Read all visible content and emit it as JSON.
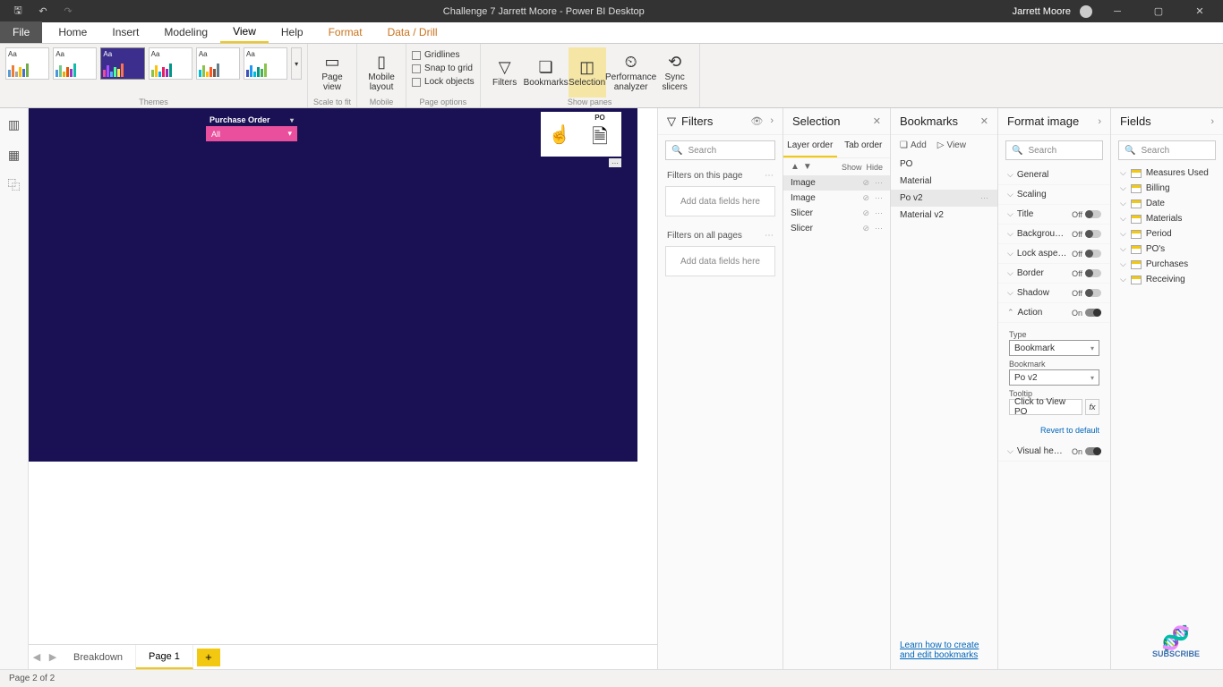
{
  "titlebar": {
    "title": "Challenge 7 Jarrett Moore - Power BI Desktop",
    "user": "Jarrett Moore"
  },
  "menu": {
    "file": "File",
    "tabs": [
      "Home",
      "Insert",
      "Modeling",
      "View",
      "Help",
      "Format",
      "Data / Drill"
    ]
  },
  "ribbon": {
    "themes_label": "Themes",
    "scale_label": "Scale to fit",
    "mobile_label": "Mobile",
    "page_options_label": "Page options",
    "show_panes_label": "Show panes",
    "page_view": "Page view",
    "mobile_layout": "Mobile layout",
    "gridlines": "Gridlines",
    "snap": "Snap to grid",
    "lock": "Lock objects",
    "filters": "Filters",
    "bookmarks": "Bookmarks",
    "selection": "Selection",
    "perf": "Performance analyzer",
    "sync": "Sync slicers"
  },
  "canvas": {
    "slicer_title": "Purchase Order",
    "slicer_value": "All",
    "po_label": "PO"
  },
  "pagetabs": {
    "tabs": [
      "Breakdown",
      "Page 1"
    ]
  },
  "filters": {
    "title": "Filters",
    "search_ph": "Search",
    "this_page": "Filters on this page",
    "add_here": "Add data fields here",
    "all_pages": "Filters on all pages"
  },
  "selection": {
    "title": "Selection",
    "layer": "Layer order",
    "tab_order": "Tab order",
    "show": "Show",
    "hide": "Hide",
    "items": [
      "Image",
      "Image",
      "Slicer",
      "Slicer"
    ]
  },
  "bookmarks": {
    "title": "Bookmarks",
    "add": "Add",
    "view": "View",
    "items": [
      "PO",
      "Material",
      "Po v2",
      "Material v2"
    ],
    "footer": "Learn how to create and edit bookmarks"
  },
  "format": {
    "title": "Format image",
    "search_ph": "Search",
    "general": "General",
    "scaling": "Scaling",
    "title_row": "Title",
    "background": "Backgrou…",
    "lock": "Lock aspe…",
    "border": "Border",
    "shadow": "Shadow",
    "action": "Action",
    "visual_header": "Visual he…",
    "off": "Off",
    "on": "On",
    "type_label": "Type",
    "type_value": "Bookmark",
    "bookmark_label": "Bookmark",
    "bookmark_value": "Po v2",
    "tooltip_label": "Tooltip",
    "tooltip_value": "Click to View PO",
    "revert": "Revert to default"
  },
  "fields": {
    "title": "Fields",
    "search_ph": "Search",
    "tables": [
      "Measures Used",
      "Billing",
      "Date",
      "Materials",
      "Period",
      "PO's",
      "Purchases",
      "Receiving"
    ],
    "subscribe": "SUBSCRIBE"
  },
  "status": {
    "page": "Page 2 of 2"
  }
}
